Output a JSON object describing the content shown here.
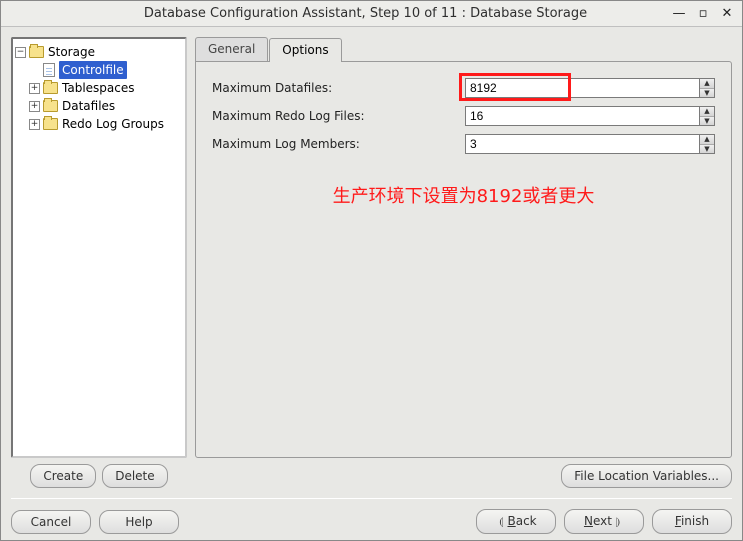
{
  "window": {
    "title": "Database Configuration Assistant, Step 10 of 11 : Database Storage"
  },
  "tree": {
    "root": "Storage",
    "items": {
      "controlfile": "Controlfile",
      "tablespaces": "Tablespaces",
      "datafiles": "Datafiles",
      "redolog": "Redo Log Groups"
    }
  },
  "left_buttons": {
    "create": "Create",
    "delete": "Delete"
  },
  "tabs": {
    "general": "General",
    "options": "Options"
  },
  "fields": {
    "max_datafiles": {
      "label": "Maximum Datafiles:",
      "value": "8192"
    },
    "max_redo": {
      "label": "Maximum Redo Log Files:",
      "value": "16"
    },
    "max_log_members": {
      "label": "Maximum Log Members:",
      "value": "3"
    }
  },
  "annotation": "生产环境下设置为8192或者更大",
  "file_location_btn": "File Location Variables...",
  "footer": {
    "cancel": "Cancel",
    "help": "Help",
    "back": "Back",
    "next": "Next",
    "finish": "Finish"
  }
}
